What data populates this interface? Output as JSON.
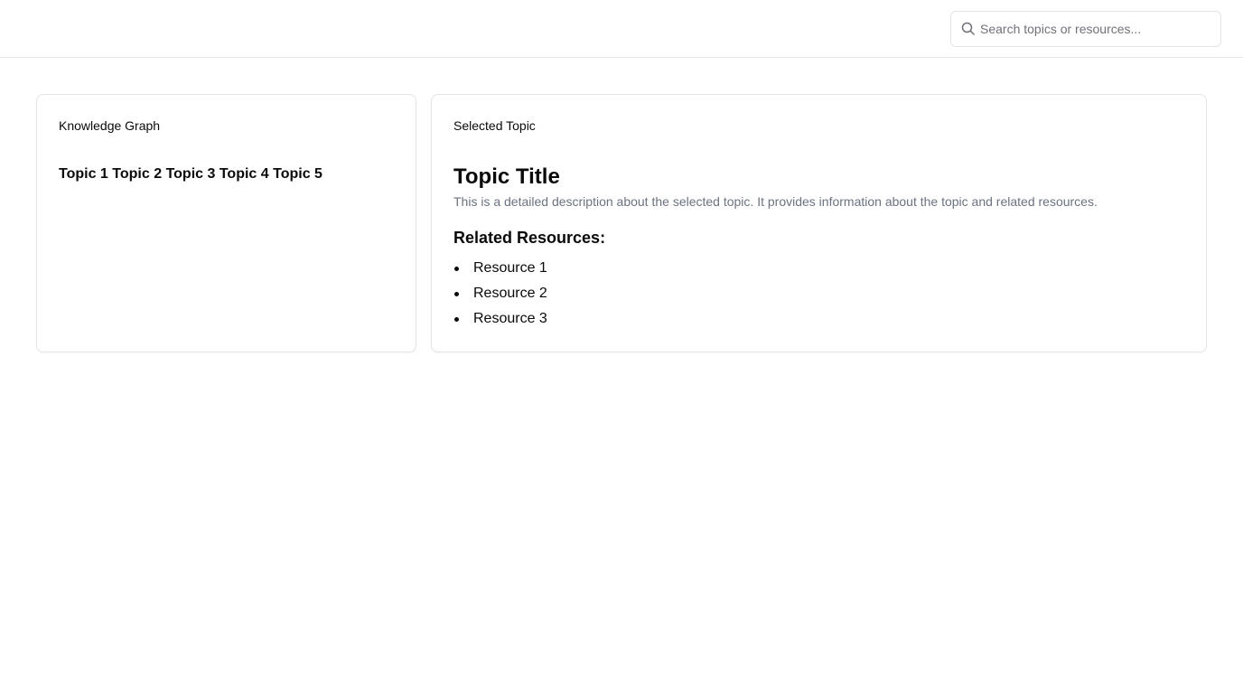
{
  "header": {
    "search": {
      "placeholder": "Search topics or resources...",
      "value": ""
    }
  },
  "graph_panel": {
    "title": "Knowledge Graph",
    "topics": [
      "Topic 1",
      "Topic 2",
      "Topic 3",
      "Topic 4",
      "Topic 5"
    ]
  },
  "topic_panel": {
    "title": "Selected Topic",
    "topic_title": "Topic Title",
    "description": "This is a detailed description about the selected topic. It provides information about the topic and related resources.",
    "resources_heading": "Related Resources:",
    "resources": [
      "Resource 1",
      "Resource 2",
      "Resource 3"
    ]
  },
  "colors": {
    "text": "#0a0a0a",
    "muted_text": "#6b7280",
    "border": "#e4e4e7",
    "background": "#ffffff"
  },
  "icons": {
    "search": "search-icon"
  }
}
